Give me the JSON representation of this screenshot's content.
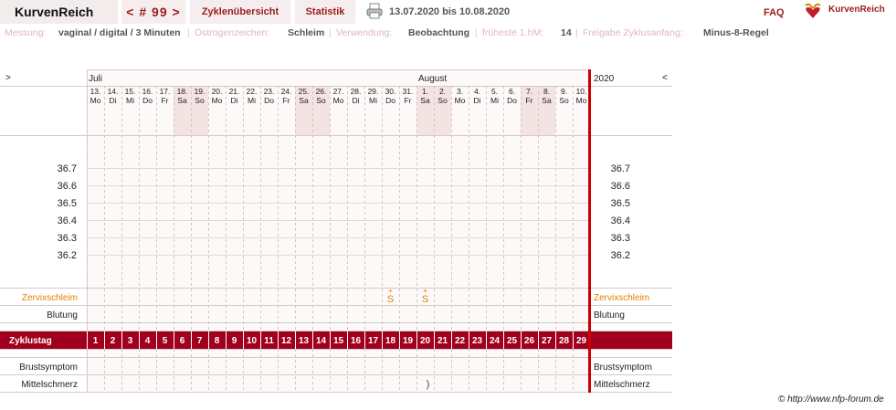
{
  "app": {
    "title": "KurvenReich"
  },
  "tabs": {
    "cycle_nav": "< # 99 >",
    "overview": "Zyklenübersicht",
    "stats": "Statistik"
  },
  "date_range": "13.07.2020 bis 10.08.2020",
  "faq": "FAQ",
  "logo_text": "KurvenReich",
  "info": {
    "measurement_label": "Messung:",
    "measurement_value": "vaginal / digital / 3 Minuten",
    "estrogen_label": "Östrogenzeichen:",
    "estrogen_value": "Schleim",
    "usage_label": "Verwendung:",
    "usage_value": "Beobachtung",
    "earliest_label": "früheste 1.hM:",
    "earliest_value": "14",
    "release_label": "Freigabe Zyklusanfang:",
    "release_value": "Minus-8-Regel"
  },
  "nav": {
    "prev": ">",
    "next": "<"
  },
  "year": "2020",
  "months": [
    {
      "label": "Juli",
      "day_index": 0
    },
    {
      "label": "August",
      "day_index": 19
    }
  ],
  "days": [
    {
      "date": "13.",
      "wd": "Mo",
      "weekend": false
    },
    {
      "date": "14.",
      "wd": "Di",
      "weekend": false
    },
    {
      "date": "15.",
      "wd": "Mi",
      "weekend": false
    },
    {
      "date": "16.",
      "wd": "Do",
      "weekend": false
    },
    {
      "date": "17.",
      "wd": "Fr",
      "weekend": false
    },
    {
      "date": "18.",
      "wd": "Sa",
      "weekend": true
    },
    {
      "date": "19.",
      "wd": "So",
      "weekend": true
    },
    {
      "date": "20.",
      "wd": "Mo",
      "weekend": false
    },
    {
      "date": "21.",
      "wd": "Di",
      "weekend": false
    },
    {
      "date": "22.",
      "wd": "Mi",
      "weekend": false
    },
    {
      "date": "23.",
      "wd": "Do",
      "weekend": false
    },
    {
      "date": "24.",
      "wd": "Fr",
      "weekend": false
    },
    {
      "date": "25.",
      "wd": "Sa",
      "weekend": true
    },
    {
      "date": "26.",
      "wd": "So",
      "weekend": true
    },
    {
      "date": "27.",
      "wd": "Mo",
      "weekend": false
    },
    {
      "date": "28.",
      "wd": "Di",
      "weekend": false
    },
    {
      "date": "29.",
      "wd": "Mi",
      "weekend": false
    },
    {
      "date": "30.",
      "wd": "Do",
      "weekend": false
    },
    {
      "date": "31.",
      "wd": "Fr",
      "weekend": false
    },
    {
      "date": "1.",
      "wd": "Sa",
      "weekend": true
    },
    {
      "date": "2.",
      "wd": "So",
      "weekend": true
    },
    {
      "date": "3.",
      "wd": "Mo",
      "weekend": false
    },
    {
      "date": "4.",
      "wd": "Di",
      "weekend": false
    },
    {
      "date": "5.",
      "wd": "Mi",
      "weekend": false
    },
    {
      "date": "6.",
      "wd": "Do",
      "weekend": false
    },
    {
      "date": "7.",
      "wd": "Fr",
      "weekend": true
    },
    {
      "date": "8.",
      "wd": "Sa",
      "weekend": true
    },
    {
      "date": "9.",
      "wd": "So",
      "weekend": false
    },
    {
      "date": "10.",
      "wd": "Mo",
      "weekend": false
    }
  ],
  "temp_ticks": [
    "36.7",
    "36.6",
    "36.5",
    "36.4",
    "36.3",
    "36.2"
  ],
  "rows": {
    "mucus": "Zervixschleim",
    "bleeding": "Blutung",
    "cycle_day": "Zyklustag",
    "breast": "Brustsymptom",
    "midpain": "Mittelschmerz"
  },
  "mucus_marks": [
    {
      "day_index": 17,
      "symbol": "S",
      "sup": "+"
    },
    {
      "day_index": 19,
      "symbol": "S",
      "sup": "+"
    }
  ],
  "midpain_marks": [
    {
      "day_index": 19,
      "symbol": ")"
    }
  ],
  "copyright": "© http://www.nfp-forum.de",
  "colors": {
    "accent": "#9b1c1c",
    "cycle_bar": "#a0001e",
    "weekend": "#f3e3e3",
    "mucus": "#e08000",
    "cursor": "#cc0000"
  }
}
